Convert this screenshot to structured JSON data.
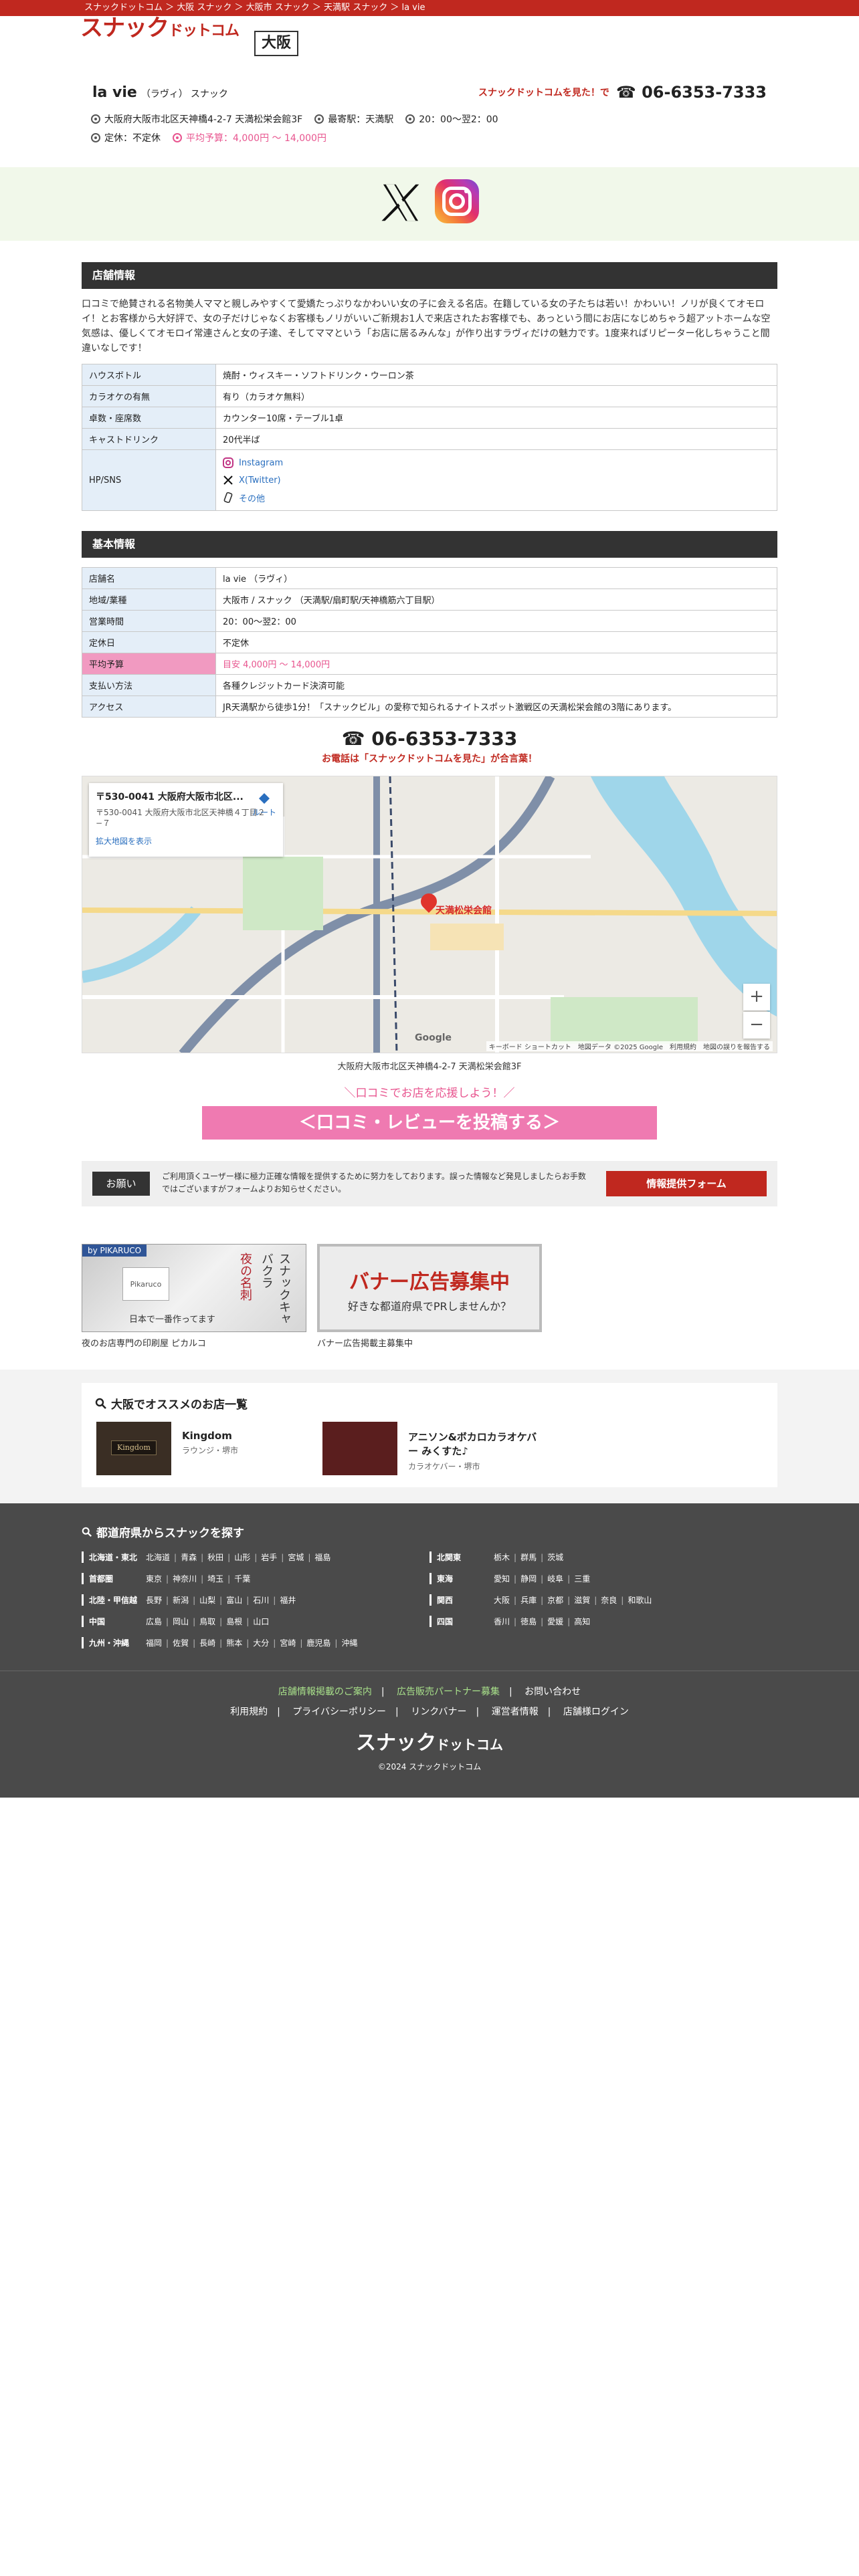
{
  "breadcrumb": "スナックドットコム ＞ 大阪 スナック ＞ 大阪市 スナック ＞ 天満駅 スナック ＞ la vie",
  "logo": {
    "main": "スナック",
    "sub": "ドットコム"
  },
  "pref_badge": "大阪",
  "shop": {
    "name": "la vie",
    "kana": "（ラヴィ）",
    "genre": "スナック",
    "tel_note": "スナックドットコムを見た！で",
    "tel": "☎ 06-6353-7333",
    "address": "大阪府大阪市北区天神橋4-2-7 天満松栄会館3F",
    "station": "最寄駅：天満駅",
    "hours": "20：00～翌2：00",
    "holiday": "定休：不定休",
    "budget": "平均予算：4,000円 ～ 14,000円"
  },
  "sections": {
    "shop_info": "店舗情報",
    "basic_info": "基本情報"
  },
  "intro": "口コミで絶賛される名物美人ママと親しみやすくて愛嬌たっぷりなかわいい女の子に会える名店。在籍している女の子たちは若い！かわいい！ノリが良くてオモロイ！とお客様から大好評で、女の子だけじゃなくお客様もノリがいいご新規お1人で来店されたお客様でも、あっという間にお店になじめちゃう超アットホームな空気感は、優しくてオモロイ常連さんと女の子達、そしてママという「お店に居るみんな」が作り出すラヴィだけの魅力です。1度来ればリピーター化しちゃうこと間違いなしです！",
  "shop_table": [
    {
      "k": "ハウスボトル",
      "v": "焼酎・ウィスキー・ソフトドリンク・ウーロン茶"
    },
    {
      "k": "カラオケの有無",
      "v": "有り（カラオケ無料）"
    },
    {
      "k": "卓数・座席数",
      "v": "カウンター10席・テーブル1卓"
    },
    {
      "k": "キャストドリンク",
      "v": "20代半ば"
    }
  ],
  "sns_label": "HP/SNS",
  "sns": [
    {
      "label": "Instagram",
      "icon": "instagram-icon"
    },
    {
      "label": "X(Twitter)",
      "icon": "x-icon"
    },
    {
      "label": "その他",
      "icon": "phone-icon"
    }
  ],
  "basic_table": [
    {
      "k": "店舗名",
      "v": "la vie （ラヴィ）"
    },
    {
      "k": "地域/業種",
      "v": "大阪市 / スナック （天満駅/扇町駅/天神橋筋六丁目駅）"
    },
    {
      "k": "営業時間",
      "v": "20：00～翌2：00"
    },
    {
      "k": "定休日",
      "v": "不定休"
    },
    {
      "k": "平均予算",
      "v": "目安 4,000円 ～ 14,000円",
      "hl": true
    },
    {
      "k": "支払い方法",
      "v": "各種クレジットカード決済可能"
    },
    {
      "k": "アクセス",
      "v": "JR天満駅から徒歩1分！「スナックビル」の愛称で知られるナイトスポット激戦区の天満松栄会館の3階にあります。"
    }
  ],
  "tel_center": "☎ 06-6353-7333",
  "tel_center_note": "お電話は「スナックドットコムを見た」が合言葉！",
  "map": {
    "card_title": "〒530-0041 大阪府大阪市北区...",
    "card_addr": "〒530-0041 大阪府大阪市北区天神橋４丁目２−７",
    "card_link": "拡大地図を表示",
    "route": "ルート",
    "pin_label": "天満松栄会館",
    "google": "Google",
    "footer": "キーボード ショートカット　地図データ ©2025 Google　利用規約　地図の誤りを報告する"
  },
  "map_address": "大阪府大阪市北区天神橋4-2-7 天満松栄会館3F",
  "support": "＼口コミでお店を応援しよう！／",
  "review_button": "＜口コミ・レビューを投稿する＞",
  "ask": {
    "badge": "お願い",
    "text": "ご利用頂くユーザー様に極力正確な情報を提供するために努力をしております。誤った情報など発見しましたらお手数ではございますがフォームよりお知らせください。",
    "button": "情報提供フォーム"
  },
  "banners": [
    {
      "tag": "by PIKARUCO",
      "caption": "夜のお店専門の印刷屋 ピカルコ",
      "v1": "スナックキャバクラ",
      "v2": "夜の名刺",
      "bottom": "日本で一番作ってます"
    },
    {
      "caption": "バナー広告掲載主募集中",
      "headline": "バナー広告募集中",
      "sub": "好きな都道府県でPRしませんか？"
    }
  ],
  "recommend": {
    "title": "大阪でオススメのお店一覧",
    "items": [
      {
        "name": "Kingdom",
        "sub": "ラウンジ・堺市",
        "sign": "Kingdom"
      },
      {
        "name": "アニソン&ボカロカラオケバー みくすた♪",
        "sub": "カラオケバー・堺市",
        "sign": ""
      }
    ]
  },
  "prefs_title": "都道府県からスナックを探す",
  "regions_left": [
    {
      "name": "北海道・東北",
      "list": [
        "北海道",
        "青森",
        "秋田",
        "山形",
        "岩手",
        "宮城",
        "福島"
      ]
    },
    {
      "name": "首都圏",
      "list": [
        "東京",
        "神奈川",
        "埼玉",
        "千葉"
      ]
    },
    {
      "name": "北陸・甲信越",
      "list": [
        "長野",
        "新潟",
        "山梨",
        "富山",
        "石川",
        "福井"
      ]
    },
    {
      "name": "中国",
      "list": [
        "広島",
        "岡山",
        "鳥取",
        "島根",
        "山口"
      ]
    },
    {
      "name": "九州・沖縄",
      "list": [
        "福岡",
        "佐賀",
        "長崎",
        "熊本",
        "大分",
        "宮崎",
        "鹿児島",
        "沖縄"
      ]
    }
  ],
  "regions_right": [
    {
      "name": "北関東",
      "list": [
        "栃木",
        "群馬",
        "茨城"
      ]
    },
    {
      "name": "東海",
      "list": [
        "愛知",
        "静岡",
        "岐阜",
        "三重"
      ]
    },
    {
      "name": "関西",
      "list": [
        "大阪",
        "兵庫",
        "京都",
        "滋賀",
        "奈良",
        "和歌山"
      ]
    },
    {
      "name": "四国",
      "list": [
        "香川",
        "徳島",
        "愛媛",
        "高知"
      ]
    }
  ],
  "footer": {
    "links1": [
      "店舗情報掲載のご案内",
      "広告販売パートナー募集",
      "お問い合わせ"
    ],
    "links2": [
      "利用規約",
      "プライバシーポリシー",
      "リンクバナー",
      "運営者情報",
      "店舗様ログイン"
    ],
    "logo_main": "スナック",
    "logo_sub": "ドットコム",
    "copyright": "©2024 スナックドットコム"
  }
}
